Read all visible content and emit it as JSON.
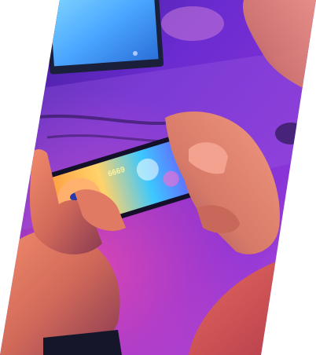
{
  "image": {
    "subject": "hands-holding-smartphone-playing-game",
    "palette": {
      "background_purple": "#6a2bd0",
      "background_magenta": "#c03ad8",
      "monitor_glow": "#58b4ff",
      "skin_warm": "#e07a5f",
      "skin_shadow": "#8a3a52",
      "phone_body": "#1a1430",
      "screen_cyan": "#3cc8ff",
      "screen_orange": "#ff9a3c"
    },
    "game_screen": {
      "score_text": "6669"
    }
  }
}
